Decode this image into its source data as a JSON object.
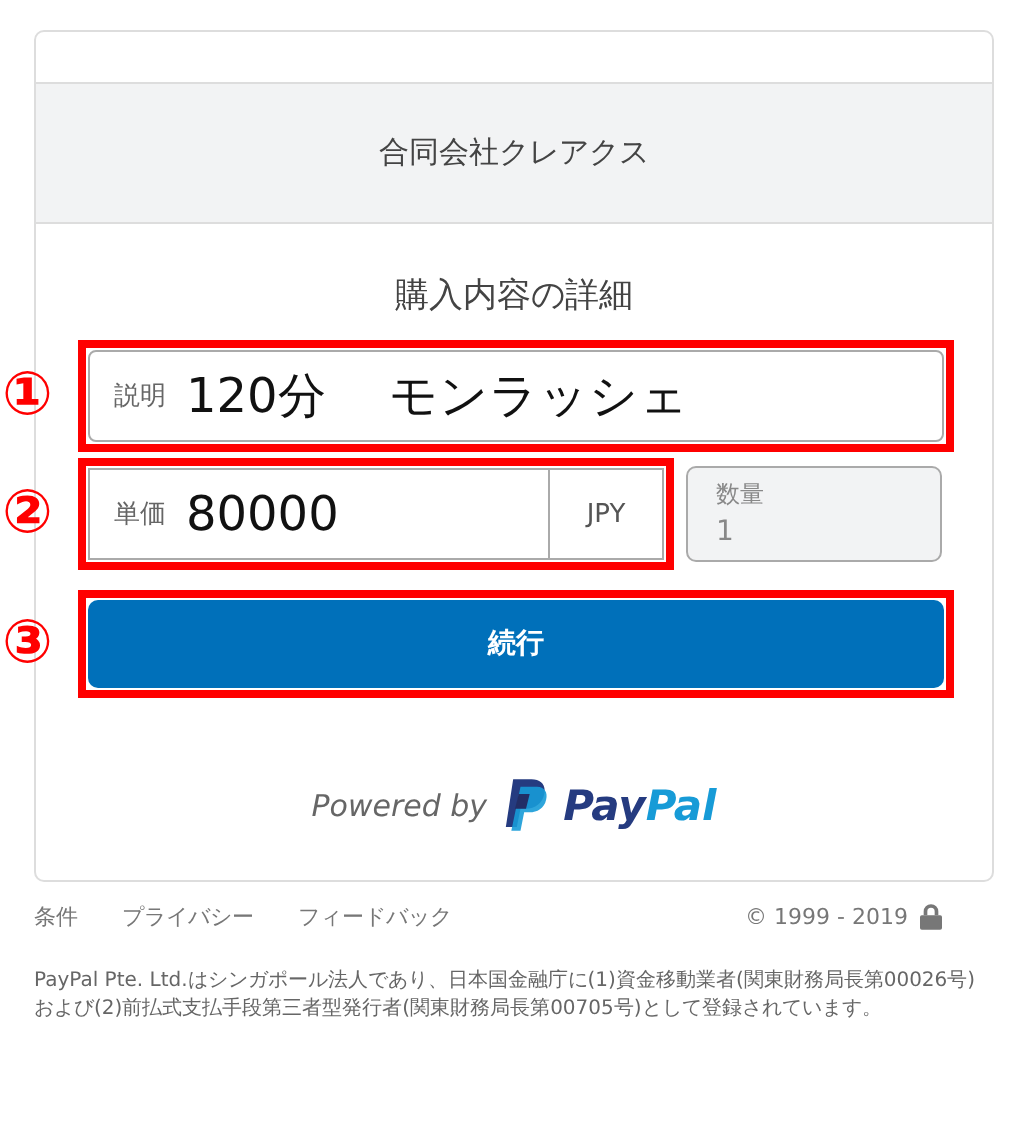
{
  "company": "合同会社クレアクス",
  "heading": "購入内容の詳細",
  "rows": [
    {
      "kind": "description",
      "annotation": "①",
      "label": "説明",
      "value": "120分　 モンラッシェ"
    },
    {
      "kind": "price",
      "annotation": "②",
      "label": "単価",
      "value": "80000",
      "currency": "JPY",
      "quantity": {
        "label": "数量",
        "value": "1"
      }
    },
    {
      "kind": "button",
      "annotation": "③",
      "label": "続行"
    }
  ],
  "powered_by": {
    "text": "Powered by",
    "brand": [
      "Pay",
      "Pal"
    ]
  },
  "footer": {
    "links": [
      "条件",
      "プライバシー",
      "フィードバック"
    ],
    "copyright": "© 1999 - 2019"
  },
  "legal": "PayPal Pte. Ltd.はシンガポール法人であり、日本国金融庁に(1)資金移動業者(関東財務局長第00026号)および(2)前払式支払手段第三者型発行者(関東財務局長第00705号)として登録されています。"
}
